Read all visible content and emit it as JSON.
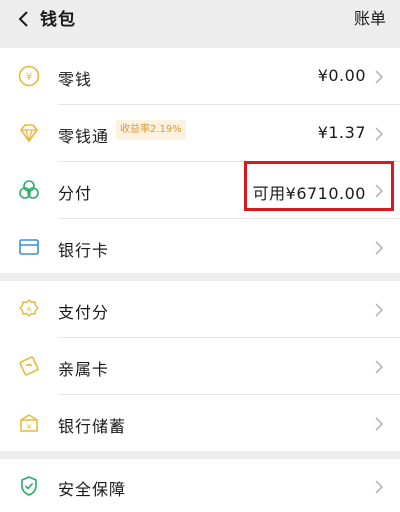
{
  "header": {
    "title": "钱包",
    "action": "账单"
  },
  "group1": {
    "items": [
      {
        "label": "零钱",
        "value": "¥0.00",
        "icon": "coin-icon"
      },
      {
        "label": "零钱通",
        "value": "¥1.37",
        "icon": "diamond-icon",
        "badge": "收益率2.19%"
      },
      {
        "label": "分付",
        "value": "可用¥6710.00",
        "icon": "clover-icon"
      },
      {
        "label": "银行卡",
        "value": "",
        "icon": "bank-card-icon"
      }
    ]
  },
  "group2": {
    "items": [
      {
        "label": "支付分",
        "value": "",
        "icon": "score-badge-icon"
      },
      {
        "label": "亲属卡",
        "value": "",
        "icon": "family-card-icon"
      },
      {
        "label": "银行储蓄",
        "value": "",
        "icon": "savings-box-icon"
      }
    ]
  },
  "group3": {
    "items": [
      {
        "label": "安全保障",
        "value": "",
        "icon": "shield-check-icon"
      }
    ]
  },
  "colors": {
    "accent_gold": "#e8b83a",
    "accent_green": "#2aae67",
    "highlight_red": "#d9191e",
    "badge_bg": "#fdf1e0",
    "badge_text": "#d9993a"
  }
}
